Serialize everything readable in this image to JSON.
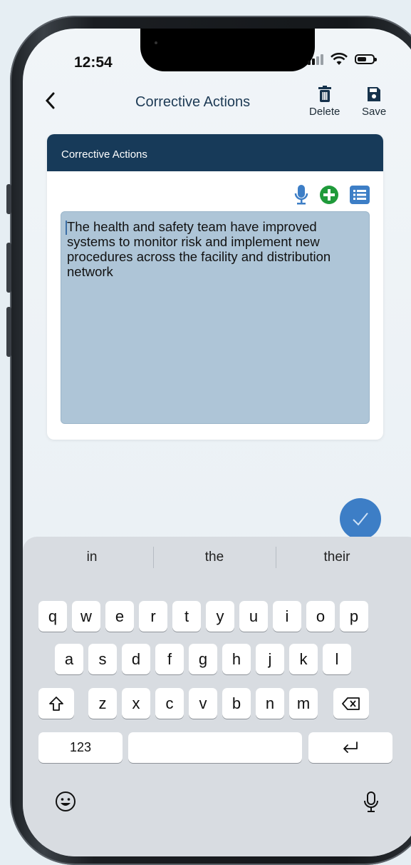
{
  "status": {
    "time": "12:54"
  },
  "nav": {
    "title": "Corrective Actions",
    "delete_label": "Delete",
    "save_label": "Save"
  },
  "card": {
    "header": "Corrective Actions",
    "text": "The health and safety team have improved systems to monitor risk and implement new procedures across the facility and distribution network"
  },
  "colors": {
    "header": "#173a59",
    "accent": "#3d7ec6",
    "add": "#1f9a3a",
    "textarea": "#aec5d7"
  },
  "keyboard": {
    "suggestions": [
      "in",
      "the",
      "their"
    ],
    "row1": [
      "q",
      "w",
      "e",
      "r",
      "t",
      "y",
      "u",
      "i",
      "o",
      "p"
    ],
    "row2": [
      "a",
      "s",
      "d",
      "f",
      "g",
      "h",
      "j",
      "k",
      "l"
    ],
    "row3": [
      "z",
      "x",
      "c",
      "v",
      "b",
      "n",
      "m"
    ],
    "numbers_label": "123"
  },
  "icons": [
    "back-chevron-icon",
    "trash-icon",
    "save-icon",
    "microphone-icon",
    "add-circle-icon",
    "list-icon",
    "checkmark-icon",
    "shift-icon",
    "backspace-icon",
    "return-icon",
    "emoji-icon",
    "dictation-icon"
  ]
}
